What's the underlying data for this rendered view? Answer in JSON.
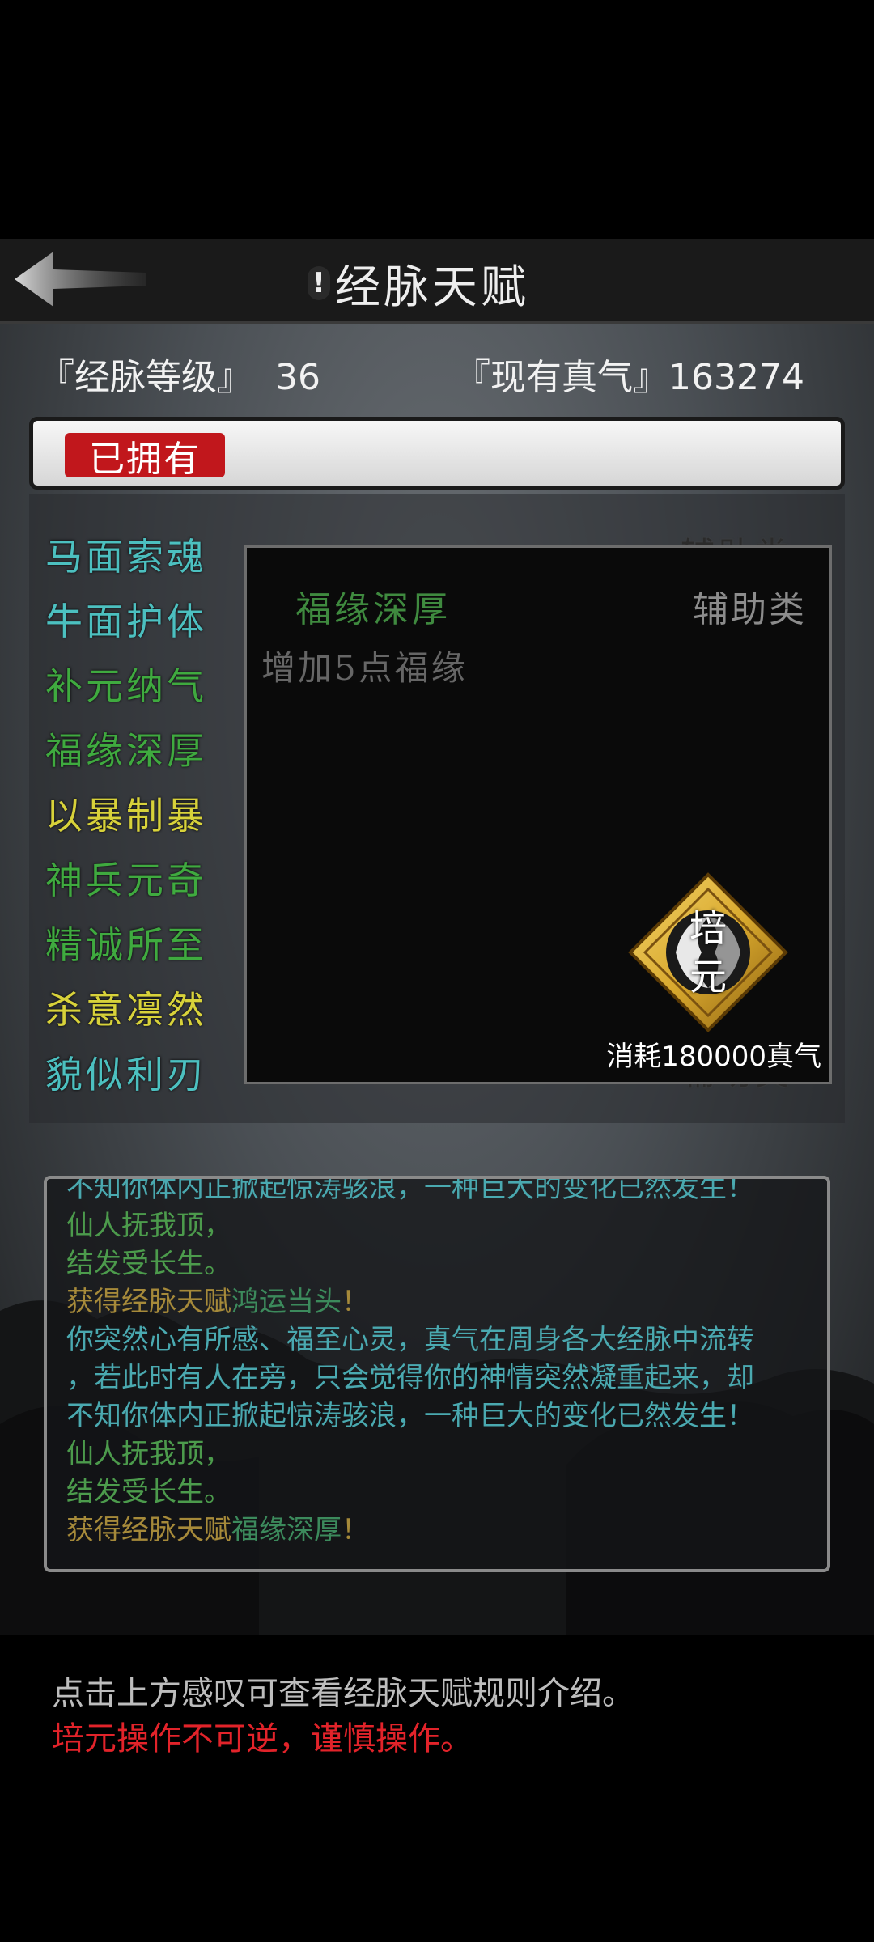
{
  "header": {
    "back_icon": "back-arrow-icon",
    "info_mark": "!",
    "title": "经脉天赋"
  },
  "stats": {
    "level_label": "『经脉等级』",
    "level_value": "36",
    "qi_label": "『现有真气』",
    "qi_value": "163274"
  },
  "tab": {
    "owned_label": "已拥有"
  },
  "talents": [
    {
      "name": "马面索魂",
      "category": "辅助类",
      "color": "#4cc0c0"
    },
    {
      "name": "牛面护体",
      "category": "辅助类",
      "color": "#4cc0c0"
    },
    {
      "name": "补元纳气",
      "category": "辅助类",
      "color": "#3faa3f"
    },
    {
      "name": "福缘深厚",
      "category": "辅助类",
      "color": "#3faa3f"
    },
    {
      "name": "以暴制暴",
      "category": "辅助类",
      "color": "#d8d23a"
    },
    {
      "name": "神兵元奇",
      "category": "辅助类",
      "color": "#3faa3f"
    },
    {
      "name": "精诚所至",
      "category": "辅助类",
      "color": "#3faa3f"
    },
    {
      "name": "杀意凛然",
      "category": "辅助类",
      "color": "#d8d23a"
    },
    {
      "name": "貌似利刃",
      "category": "辅助类",
      "color": "#4cc0c0"
    }
  ],
  "detail": {
    "name": "福缘深厚",
    "category": "辅助类",
    "description": "增加5点福缘",
    "cultivate_top": "培",
    "cultivate_bottom": "元",
    "cost": "消耗180000真气"
  },
  "log": [
    {
      "text": "不知你体内正掀起惊涛骇浪，一种巨大的变化已然发生！",
      "style": "teal"
    },
    {
      "text": "仙人抚我顶，",
      "style": "green"
    },
    {
      "text": "结发受长生。",
      "style": "green"
    },
    {
      "pre": "获得经脉天赋",
      "talent": "鸿运当头",
      "post": "！"
    },
    {
      "text": "你突然心有所感、福至心灵，真气在周身各大经脉中流转",
      "style": "teal"
    },
    {
      "text": "，若此时有人在旁，只会觉得你的神情突然凝重起来，却",
      "style": "teal"
    },
    {
      "text": "不知你体内正掀起惊涛骇浪，一种巨大的变化已然发生！",
      "style": "teal"
    },
    {
      "text": "仙人抚我顶，",
      "style": "green"
    },
    {
      "text": "结发受长生。",
      "style": "green"
    },
    {
      "pre": "获得经脉天赋",
      "talent": "福缘深厚",
      "post": "！"
    }
  ],
  "tips": {
    "line1": "点击上方感叹可查看经脉天赋规则介绍。",
    "line2": "培元操作不可逆，谨慎操作。"
  }
}
